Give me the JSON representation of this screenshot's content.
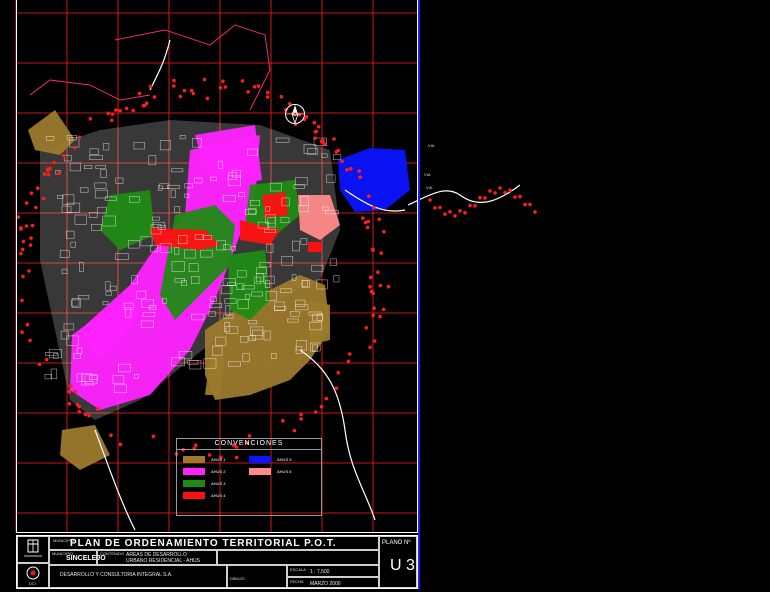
{
  "map": {
    "colors": {
      "background": "#000000",
      "grid": "#ff2020",
      "street": "#ffffff",
      "boundary": "#ff2d6f",
      "marker": "#ff1e1e",
      "ahus1": "#9c7a2c",
      "ahus2": "#ff22ff",
      "ahus3": "#1f8a13",
      "ahus4": "#ff1010",
      "ahus5": "#0a14ff",
      "ahus6": "#ff8a8a",
      "blank": "#000000"
    },
    "legend": {
      "title": "CONVENCIONES",
      "items": [
        {
          "label": "AHUS 1",
          "color": "#9c7a2c"
        },
        {
          "label": "AHUS 2",
          "color": "#ff22ff"
        },
        {
          "label": "AHUS 3",
          "color": "#1f8a13"
        },
        {
          "label": "AHUS 4",
          "color": "#ff1010"
        },
        {
          "label": "AHUS 5",
          "color": "#0a14ff"
        },
        {
          "label": "AHUS 6",
          "color": "#ff8a8a"
        }
      ]
    },
    "road_labels": [
      "VIA",
      "VIA",
      "VIA"
    ],
    "north_icon": "north-arrow-icon"
  },
  "title_block": {
    "title": "PLAN DE ORDENAMIENTO TERRITORIAL P.O.T.",
    "plano_label": "PLANO Nº",
    "plano_number": "U 3",
    "municipality": "SINCELEJO",
    "subject_line1": "AREAS DE DESARROLLO",
    "subject_line2": "URBANO RESIDENCIAL - AHUS",
    "company": "DESARROLLO Y CONSULTORIA INTEGRAL S.A.",
    "scale": "1 : 7,500",
    "date": "MARZO 2000",
    "small_labels": [
      "MUNICIPIO",
      "CONTENIDO",
      "ESCALA",
      "FECHA",
      "DIBUJO",
      "REVISO"
    ],
    "logo_text": "DCI"
  }
}
